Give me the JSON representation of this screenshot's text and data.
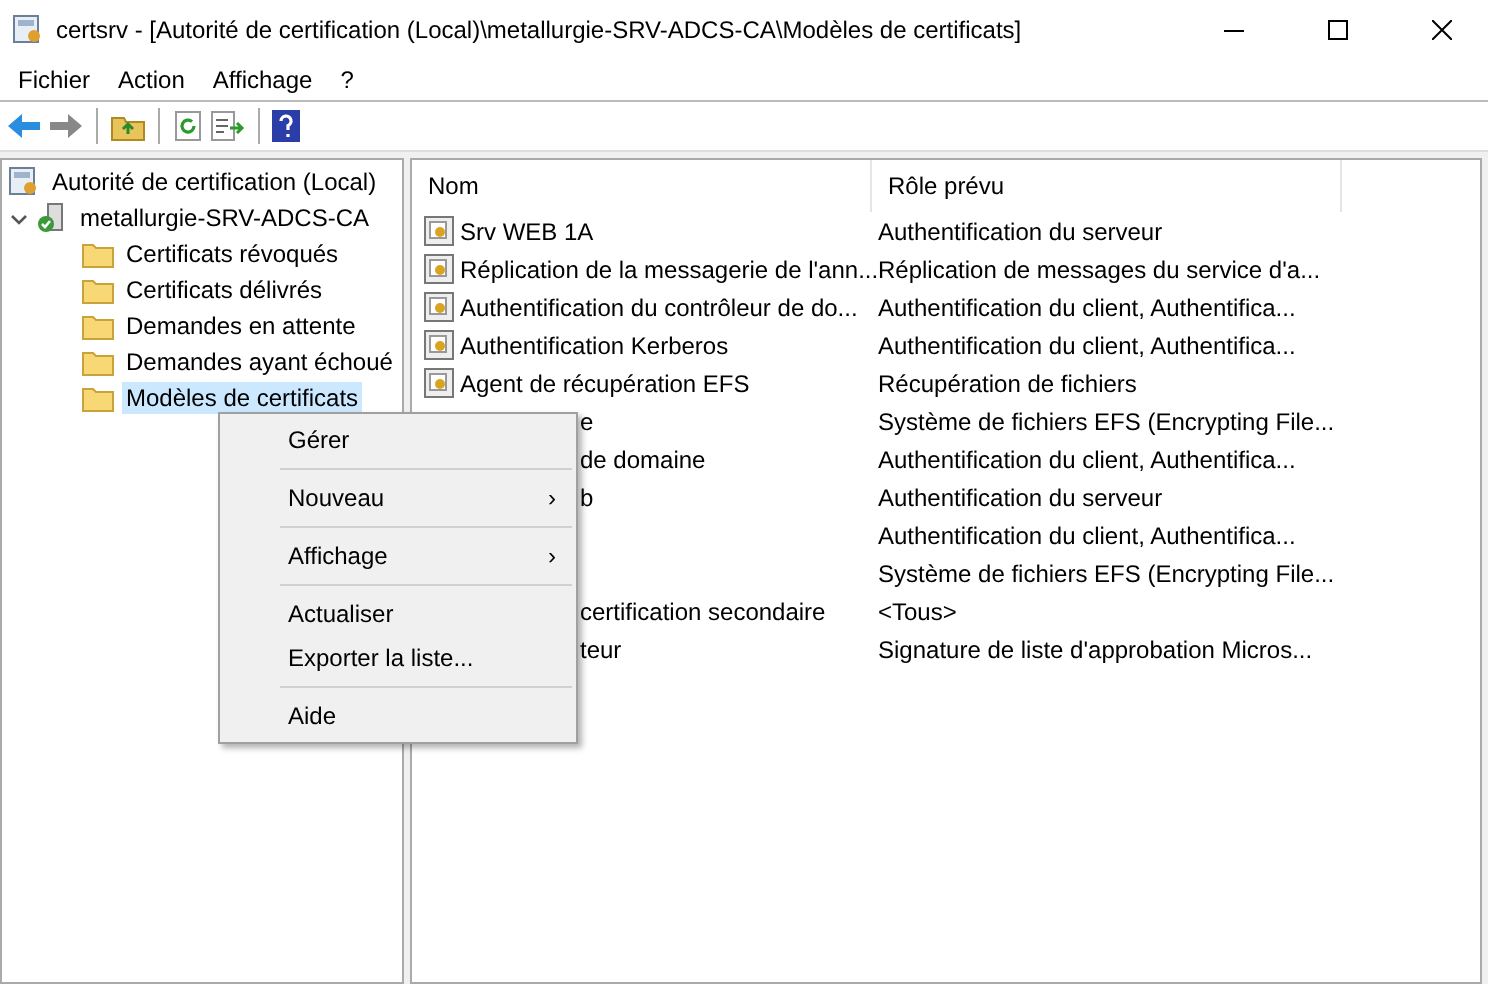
{
  "window": {
    "title": "certsrv - [Autorité de certification (Local)\\metallurgie-SRV-ADCS-CA\\Modèles de certificats]"
  },
  "menu_bar": [
    "Fichier",
    "Action",
    "Affichage",
    "?"
  ],
  "tree": [
    {
      "label": "Autorité de certification (Local)",
      "kind": "authority",
      "selected": false,
      "children": [
        {
          "label": "metallurgie-SRV-ADCS-CA",
          "kind": "server",
          "selected": false,
          "expanded": true,
          "children": [
            {
              "label": "Certificats révoqués",
              "kind": "folder",
              "selected": false
            },
            {
              "label": "Certificats délivrés",
              "kind": "folder",
              "selected": false
            },
            {
              "label": "Demandes en attente",
              "kind": "folder",
              "selected": false
            },
            {
              "label": "Demandes ayant échoué",
              "kind": "folder",
              "selected": false
            },
            {
              "label": "Modèles de certificats",
              "kind": "folder",
              "selected": true
            }
          ]
        }
      ]
    }
  ],
  "table": {
    "columns": [
      "Nom",
      "Rôle prévu"
    ],
    "rows": [
      {
        "kind": "full",
        "name": "Srv WEB 1A",
        "role": "Authentification du serveur"
      },
      {
        "kind": "full",
        "name": "Réplication de la messagerie de l'ann...",
        "role": "Réplication de messages du service d'a..."
      },
      {
        "kind": "full",
        "name": "Authentification du contrôleur de do...",
        "role": "Authentification du client, Authentifica..."
      },
      {
        "kind": "full",
        "name": "Authentification Kerberos",
        "role": "Authentification du client, Authentifica..."
      },
      {
        "kind": "full",
        "name": "Agent de récupération EFS",
        "role": "Récupération de fichiers"
      },
      {
        "kind": "covered",
        "name": "e",
        "role": "Système de fichiers EFS (Encrypting File..."
      },
      {
        "kind": "covered",
        "name": "de domaine",
        "role": "Authentification du client, Authentifica..."
      },
      {
        "kind": "covered",
        "name": "b",
        "role": "Authentification du serveur"
      },
      {
        "kind": "covered",
        "role": "Authentification du client, Authentifica..."
      },
      {
        "kind": "covered",
        "role": "Système de fichiers EFS (Encrypting File..."
      },
      {
        "kind": "covered",
        "name": "certification secondaire",
        "role": "<Tous>"
      },
      {
        "kind": "covered",
        "name": "teur",
        "role": "Signature de liste d'approbation Micros..."
      }
    ]
  },
  "context_menu": [
    {
      "kind": "item",
      "label": "Gérer"
    },
    {
      "kind": "separator"
    },
    {
      "kind": "submenu",
      "label": "Nouveau",
      "arrow": "›"
    },
    {
      "kind": "separator"
    },
    {
      "kind": "submenu",
      "label": "Affichage",
      "arrow": "›"
    },
    {
      "kind": "separator"
    },
    {
      "kind": "item",
      "label": "Actualiser"
    },
    {
      "kind": "item",
      "label": "Exporter la liste..."
    },
    {
      "kind": "separator"
    },
    {
      "kind": "item",
      "label": "Aide"
    }
  ]
}
